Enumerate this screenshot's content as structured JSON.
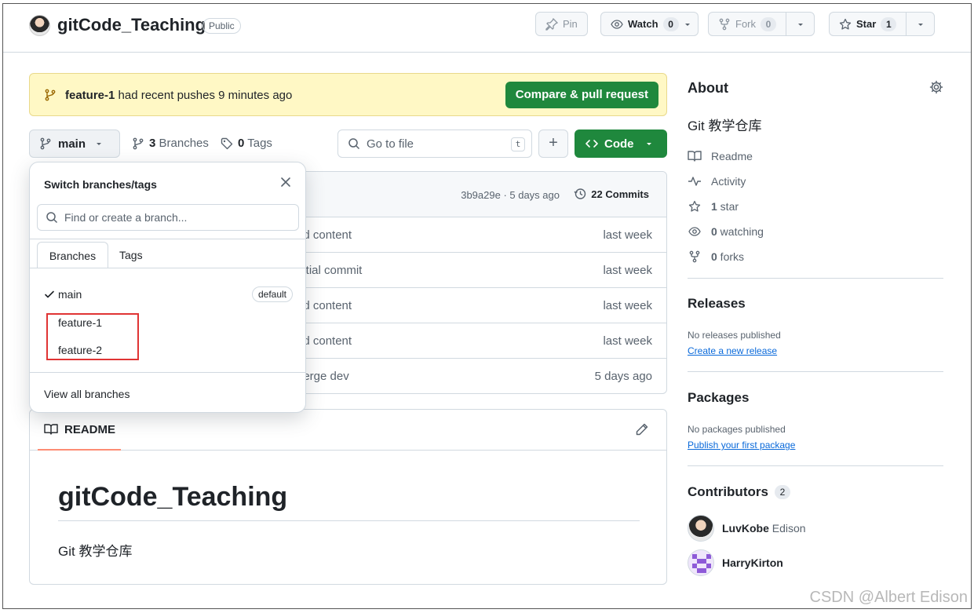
{
  "header": {
    "repo_name": "gitCode_Teaching",
    "visibility": "Public",
    "pin_label": "Pin",
    "watch_label": "Watch",
    "watch_count": "0",
    "fork_label": "Fork",
    "fork_count": "0",
    "star_label": "Star",
    "star_count": "1"
  },
  "banner": {
    "branch": "feature-1",
    "message": " had recent pushes 9 minutes ago",
    "button": "Compare & pull request"
  },
  "toolbar": {
    "branch": "main",
    "branches_count": "3",
    "branches_label": " Branches",
    "tags_count": "0",
    "tags_label": " Tags",
    "goto_placeholder": "Go to file",
    "goto_key": "t",
    "code_label": "Code"
  },
  "commit": {
    "meta": "3b9a29e · 5 days ago",
    "commits": "22 Commits"
  },
  "files": [
    {
      "message": "dd content",
      "when": "last week"
    },
    {
      "message": "nitial commit",
      "when": "last week"
    },
    {
      "message": "dd content",
      "when": "last week"
    },
    {
      "message": "dd content",
      "when": "last week"
    },
    {
      "message": "nerge dev",
      "when": "5 days ago"
    }
  ],
  "dropdown": {
    "title": "Switch branches/tags",
    "search_placeholder": "Find or create a branch...",
    "tab_branches": "Branches",
    "tab_tags": "Tags",
    "branches": [
      {
        "name": "main",
        "badge": "default"
      },
      {
        "name": "feature-1"
      },
      {
        "name": "feature-2"
      }
    ],
    "view_all": "View all branches"
  },
  "readme": {
    "tab_label": "README",
    "title": "gitCode_Teaching",
    "body": "Git 教学仓库"
  },
  "sidebar": {
    "about_title": "About",
    "description": "Git 教学仓库",
    "readme": "Readme",
    "activity": "Activity",
    "stars_count": "1",
    "stars_label": " star",
    "watching_count": "0",
    "watching_label": " watching",
    "forks_count": "0",
    "forks_label": " forks",
    "releases_title": "Releases",
    "releases_none": "No releases published",
    "releases_link": "Create a new release",
    "packages_title": "Packages",
    "packages_none": "No packages published",
    "packages_link": "Publish your first package",
    "contributors_title": "Contributors",
    "contributors_count": "2",
    "contributors": [
      {
        "login": "LuvKobe",
        "name": "Edison"
      },
      {
        "login": "HarryKirton",
        "name": ""
      }
    ]
  },
  "watermark": "CSDN @Albert Edison",
  "colors": {
    "accent_green": "#1f883d",
    "banner_yellow": "#fff8c5",
    "link_blue": "#0969da",
    "highlight_red": "#e03434"
  }
}
